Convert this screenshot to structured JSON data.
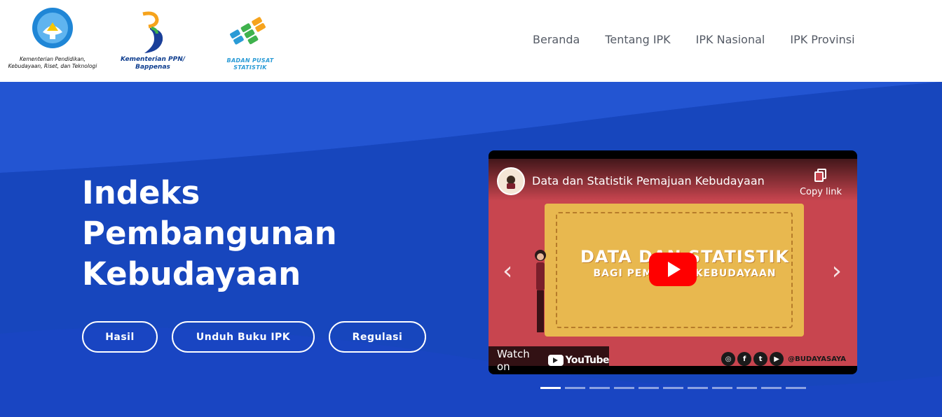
{
  "header": {
    "logos": [
      {
        "name": "kemdikbud",
        "caption_lines": [
          "Kementerian Pendidikan,",
          "Kebudayaan, Riset, dan Teknologi"
        ]
      },
      {
        "name": "bappenas",
        "caption_lines": [
          "Kementerian PPN/",
          "Bappenas"
        ]
      },
      {
        "name": "bps",
        "caption_lines": [
          "BADAN PUSAT STATISTIK"
        ]
      }
    ],
    "nav": [
      "Beranda",
      "Tentang IPK",
      "IPK Nasional",
      "IPK Provinsi"
    ]
  },
  "hero": {
    "title_lines": [
      "Indeks",
      "Pembangunan",
      "Kebudayaan"
    ],
    "buttons": [
      "Hasil",
      "Unduh Buku IPK",
      "Regulasi"
    ]
  },
  "video": {
    "title": "Data dan Statistik Pemajuan Kebudayaan",
    "copy_link": "Copy link",
    "poster_title": "DATA DAN STATISTIK",
    "poster_subtitle": "BAGI PEMAJUAN KEBUDAYAAN",
    "watch_on": "Watch on",
    "youtube": "YouTube",
    "social_handle": "@BUDAYASAYA",
    "social_icons": [
      "instagram-icon",
      "facebook-icon",
      "twitter-icon",
      "youtube-icon"
    ]
  },
  "carousel": {
    "slide_count": 11,
    "active_index": 0
  },
  "colors": {
    "hero_blue": "#1a45c7",
    "video_red": "#c8454f",
    "poster_yellow": "#e8b84f",
    "youtube_red": "#ff0000",
    "nav_text": "#555b66"
  }
}
